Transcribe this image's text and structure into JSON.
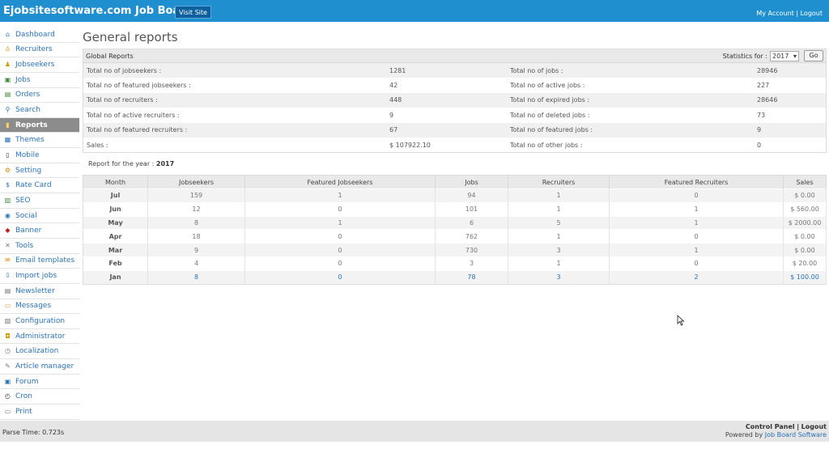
{
  "header": {
    "brand": "Ejobsitesoftware.com Job Board",
    "visit_site": "Visit Site",
    "my_account": "My Account",
    "separator": "|",
    "logout": "Logout"
  },
  "sidebar": {
    "items": [
      {
        "label": "Dashboard",
        "icon": "home-icon"
      },
      {
        "label": "Recruiters",
        "icon": "recruiter-icon"
      },
      {
        "label": "Jobseekers",
        "icon": "jobseekers-icon"
      },
      {
        "label": "Jobs",
        "icon": "jobs-icon"
      },
      {
        "label": "Orders",
        "icon": "orders-icon"
      },
      {
        "label": "Search",
        "icon": "search-icon"
      },
      {
        "label": "Reports",
        "icon": "reports-icon"
      },
      {
        "label": "Themes",
        "icon": "themes-icon"
      },
      {
        "label": "Mobile",
        "icon": "mobile-icon"
      },
      {
        "label": "Setting",
        "icon": "gear-icon"
      },
      {
        "label": "Rate Card",
        "icon": "dollar-icon"
      },
      {
        "label": "SEO",
        "icon": "seo-icon"
      },
      {
        "label": "Social",
        "icon": "globe-icon"
      },
      {
        "label": "Banner",
        "icon": "banner-icon"
      },
      {
        "label": "Tools",
        "icon": "tools-icon"
      },
      {
        "label": "Email templates",
        "icon": "email-icon"
      },
      {
        "label": "Import jobs",
        "icon": "import-icon"
      },
      {
        "label": "Newsletter",
        "icon": "newsletter-icon"
      },
      {
        "label": "Messages",
        "icon": "messages-icon"
      },
      {
        "label": "Configuration",
        "icon": "configuration-icon"
      },
      {
        "label": "Administrator",
        "icon": "lock-icon"
      },
      {
        "label": "Localization",
        "icon": "localization-icon"
      },
      {
        "label": "Article manager",
        "icon": "article-icon"
      },
      {
        "label": "Forum",
        "icon": "forum-icon"
      },
      {
        "label": "Cron",
        "icon": "clock-icon"
      },
      {
        "label": "Print",
        "icon": "print-icon"
      }
    ],
    "active": "Reports"
  },
  "main": {
    "title": "General reports",
    "global": {
      "title": "Global Reports",
      "statistics_for": "Statistics for :",
      "year": "2017",
      "go": "Go",
      "rows": [
        {
          "l1": "Total no of jobseekers :",
          "v1": "1281",
          "l2": "Total no of jobs :",
          "v2": "28946"
        },
        {
          "l1": "Total no of featured jobseekers :",
          "v1": "42",
          "l2": "Total no of active jobs :",
          "v2": "227"
        },
        {
          "l1": "Total no of recruiters :",
          "v1": "448",
          "l2": "Total no of expired jobs :",
          "v2": "28646"
        },
        {
          "l1": "Total no of active recruiters :",
          "v1": "9",
          "l2": "Total no of deleted jobs :",
          "v2": "73"
        },
        {
          "l1": "Total no of featured recruiters :",
          "v1": "67",
          "l2": "Total no of featured jobs :",
          "v2": "9"
        },
        {
          "l1": "Sales :",
          "v1": "$ 107922.10",
          "l2": "Total no of other jobs :",
          "v2": "0"
        }
      ]
    },
    "report_year_label": "Report for the year :",
    "report_year": "2017",
    "monthly": {
      "headers": [
        "Month",
        "Jobseekers",
        "Featured Jobseekers",
        "Jobs",
        "Recruiters",
        "Featured Recruiters",
        "Sales"
      ],
      "rows": [
        [
          "Jul",
          "159",
          "1",
          "94",
          "1",
          "0",
          "$ 0.00"
        ],
        [
          "Jun",
          "12",
          "0",
          "101",
          "1",
          "1",
          "$ 560.00"
        ],
        [
          "May",
          "8",
          "1",
          "6",
          "5",
          "1",
          "$ 2000.00"
        ],
        [
          "Apr",
          "18",
          "0",
          "762",
          "1",
          "0",
          "$ 0.00"
        ],
        [
          "Mar",
          "9",
          "0",
          "730",
          "3",
          "1",
          "$ 0.00"
        ],
        [
          "Feb",
          "4",
          "0",
          "3",
          "1",
          "0",
          "$ 20.00"
        ],
        [
          "Jan",
          "8",
          "0",
          "78",
          "3",
          "2",
          "$ 100.00"
        ]
      ]
    }
  },
  "footer": {
    "parse_time": "Parse Time: 0.723s",
    "control_panel": "Control Panel",
    "separator": "|",
    "logout": "Logout",
    "powered_by": "Powered by",
    "powered_link": "Job Board Software"
  }
}
